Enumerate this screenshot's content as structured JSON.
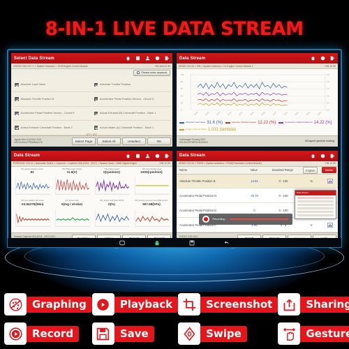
{
  "title": "8-IN-1 LIVE DATA STREAM",
  "panel_select": {
    "header_title": "Select Data Stream",
    "subbar": "V2020V V3X.XX ++ > System Selection > ECM Engine Control Module",
    "subbar_right": "VIN   100/12.3V",
    "keyboard_button": "Please enter keyword",
    "items": [
      "Absolute Load Value",
      "Absolute Throttle Position",
      "Absolute Throttle Position B",
      "Accelerator Pedal Position Sensor - Circuit D",
      "Accelerator Pedal Position Sensor - Circuit E",
      "Actual Exhaust (B) Camshaft Position  -  Bank 1",
      "Actual Exhaust Camshaft Position  -  Bank 2",
      "Actual Intake (A) Camshaft Position  -  Bank 1"
    ],
    "count": "277 / 277",
    "vin_line1": "Jaguar New XJ(X351) 2013",
    "vin_line2": "VIN:SAJAA1CT0DMM44176",
    "buttons": [
      "Select Page",
      "Select All",
      "Unselect",
      "OK"
    ],
    "header_icons": [
      "home-icon",
      "note-icon",
      "user-icon",
      "printer-icon",
      "exit-icon"
    ]
  },
  "panel_graph": {
    "header_title": "Data Stream",
    "subbar": "DEMO V13.33 > VW > System selection > 01-Engine Control Module 1",
    "subbar_right": "VIN   12.3V",
    "legend": [
      {
        "name": "Absolute Load Value",
        "value": "31.6 (%)",
        "color": "#2f5fb0"
      },
      {
        "name": "Absolute Throttle Position",
        "value": "12.22 (%)",
        "color": "#d12b28"
      },
      {
        "name": "Accelerator Pedal Position D",
        "value": "14.22 (%)",
        "color": "#9b2fb0"
      },
      {
        "name": "Oxygen Sensor Value",
        "value": "1.031 (lambda)",
        "color": "#c89a22"
      }
    ],
    "vin_line1": "Volkswagen Touareg 2013",
    "vin_line2": "VIN:WVGFF9BP4CD000000",
    "support_note": "#Support gesture scaling",
    "header_icons": [
      "home-icon",
      "printer-icon",
      "exit-icon"
    ]
  },
  "panel_mini": {
    "header_title": "Data Stream",
    "subbar": "PORSCHE V24.11 > Automatic Select > Cayenne > Cayenne 92A (2011 - 2017) > System Scan > DME Digital Engine",
    "subbar_right": "VIN   12.3V",
    "items": [
      {
        "name": "IVD_Engine selection speed",
        "value": "83",
        "color": "#2f5fb0"
      },
      {
        "name": "IVD_DME supply voltage",
        "value": "11.9(V)",
        "color": "#d12b28"
      },
      {
        "name": "IVD_Engine speed",
        "value": "0(rpm/min)",
        "color": "#7b2fb0"
      },
      {
        "name": "IVD_Nominal idle speed",
        "value": "1000(rpm/min)",
        "color": "#b8c22a"
      },
      {
        "name": "IVD_Eco adaption idle speed",
        "value": "-33.84375(/Min)",
        "color": "#c0392b"
      },
      {
        "name": "IVD_Engine load",
        "value": "0(mg / stroke)",
        "color": "#2aa34b"
      },
      {
        "name": "IVD_Engine load (SAE J1979)",
        "value": "0(%)",
        "color": "#2f5fb0"
      },
      {
        "name": "IVD_Ambient pressure from DME Control",
        "value": "997.58(hPa)",
        "color": "#c0392b"
      }
    ],
    "vin_line1": "Porsche Cayenne 92A (2011 - 2017) 2011",
    "vin_line2": "VIN:WP1ZZZ92ZBLA00001",
    "buttons": [
      "Combine",
      "Value",
      "Report",
      "Record"
    ],
    "header_icons": [
      "home-icon",
      "note-icon",
      "user-icon",
      "printer-icon",
      "exit-icon"
    ]
  },
  "panel_table": {
    "header_title": "Data Stream",
    "subbar": "DEMO V13.33 > FORD > System selection > PCM(Powertrain Control Module)",
    "subbar_right": "VIN   12.3V",
    "columns": [
      "Name",
      "Value",
      "Standard Range"
    ],
    "unit_toggle": "English",
    "metric_button": "Metric",
    "rows": [
      {
        "name": "Absolute Throttle Position B",
        "value": "14.51",
        "range": "0 - 100",
        "unit": "%"
      },
      {
        "name": "Accelerator Pedal Position D",
        "value": "33.78",
        "range": "0 - 100",
        "unit": "%"
      },
      {
        "name": "Accelerator Pedal Position E",
        "value": "0",
        "range": "0 - 100",
        "unit": "%"
      },
      {
        "name": "Accelerator Pedal Position F",
        "value": "5.95",
        "range": "0 - 5",
        "unit": "V"
      }
    ],
    "recording_label": "Recording...",
    "popup_title": "Data Stream",
    "vin_line1": "FORD F-150 2013",
    "vin_line2": "VIN:1FTMF0EF5DKE00000",
    "buttons": [
      "Graph",
      "Report",
      "Record",
      "Help"
    ],
    "header_icons": [
      "home-icon",
      "printer-icon",
      "exit-icon"
    ]
  },
  "navbar_icons": [
    "screenshot-icon",
    "android-robot-icon",
    "save-icon",
    "back-icon"
  ],
  "features": [
    {
      "label": "Graphing",
      "icon": "graphing-icon"
    },
    {
      "label": "Playback",
      "icon": "playback-icon"
    },
    {
      "label": "Screenshot",
      "icon": "screenshot-icon"
    },
    {
      "label": "Sharing",
      "icon": "sharing-icon"
    },
    {
      "label": "Record",
      "icon": "record-icon"
    },
    {
      "label": "Save",
      "icon": "save-floppy-icon"
    },
    {
      "label": "Swipe",
      "icon": "swipe-icon"
    },
    {
      "label": "Gesture",
      "icon": "gesture-icon"
    }
  ],
  "colors": {
    "brand_red": "#e4161b",
    "panel_red": "#c31b1c",
    "glow_blue": "#35b7f5"
  }
}
